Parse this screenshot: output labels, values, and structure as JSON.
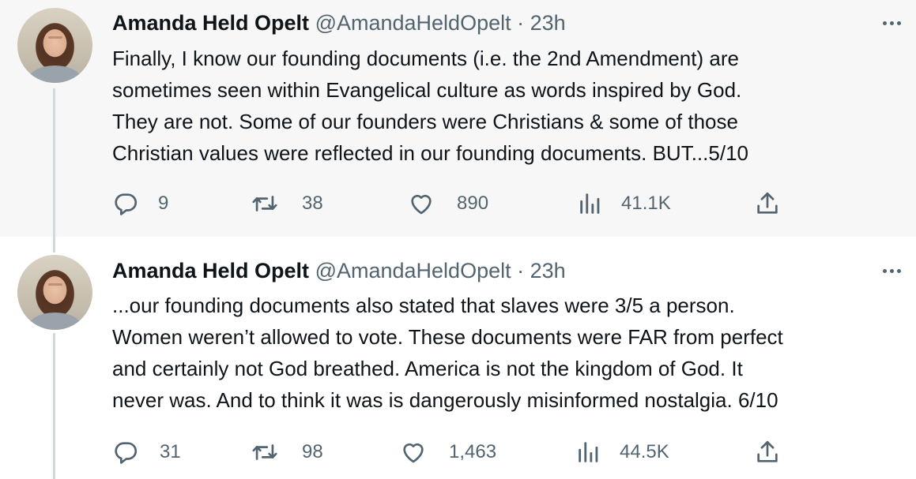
{
  "tweets": [
    {
      "author": {
        "name": "Amanda Held Opelt",
        "handle": "@AmandaHeldOpelt"
      },
      "separator": "·",
      "time": "23h",
      "text": "Finally, I know our founding documents (i.e. the 2nd Amendment) are\nsometimes seen within Evangelical culture as words inspired by God.\nThey are not. Some of our founders were Christians & some of those\nChristian values were reflected in our founding documents. BUT...5/10",
      "stats": {
        "replies": "9",
        "retweets": "38",
        "likes": "890",
        "views": "41.1K"
      }
    },
    {
      "author": {
        "name": "Amanda Held Opelt",
        "handle": "@AmandaHeldOpelt"
      },
      "separator": "·",
      "time": "23h",
      "text": "...our founding documents also stated that slaves were 3/5 a person.\nWomen weren’t allowed to vote. These documents were FAR from perfect\nand certainly not God breathed. America is not the kingdom of God. It\nnever was. And to think it was is dangerously misinformed nostalgia. 6/10",
      "stats": {
        "replies": "31",
        "retweets": "98",
        "likes": "1,463",
        "views": "44.5K"
      }
    }
  ],
  "icons": {
    "reply": "reply-icon",
    "retweet": "retweet-icon",
    "like": "heart-icon",
    "views": "views-icon",
    "share": "share-icon",
    "more": "more-icon"
  },
  "colors": {
    "text": "#0f1419",
    "secondary": "#536471",
    "thread_line": "#cfd9de",
    "highlight_bg": "#f7f7f7"
  }
}
